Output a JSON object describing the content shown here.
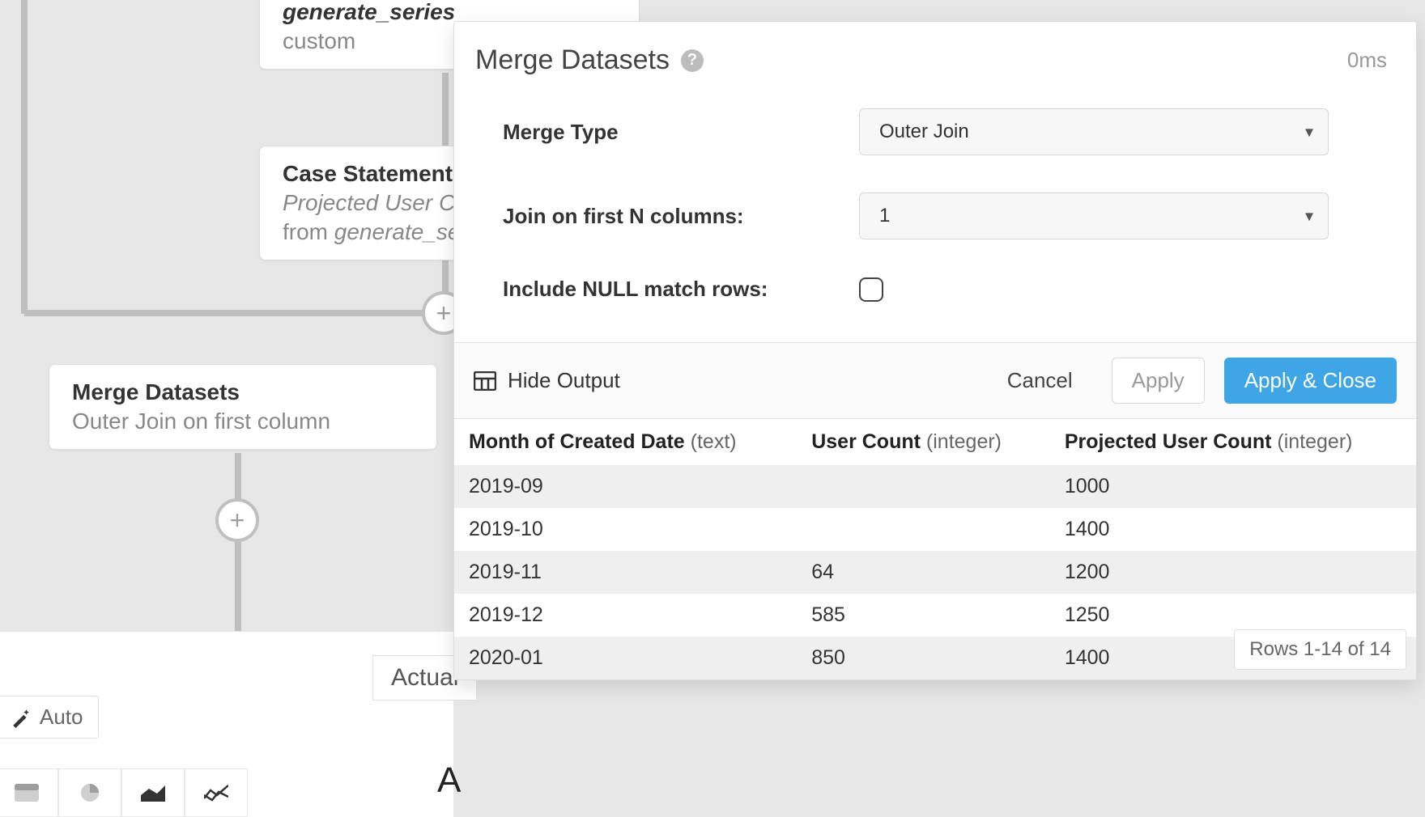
{
  "canvas": {
    "generate_series": {
      "title": "generate_series",
      "subtitle": "custom"
    },
    "case_statement": {
      "title": "Case Statement",
      "subtitle_prefix": "Projected User Cou",
      "subtitle_from": "from ",
      "subtitle_source": "generate_ser"
    },
    "merge_node": {
      "title": "Merge Datasets",
      "subtitle": "Outer Join on first column"
    }
  },
  "panel": {
    "title": "Merge Datasets",
    "timing": "0ms",
    "form": {
      "merge_type_label": "Merge Type",
      "merge_type_value": "Outer Join",
      "join_n_label": "Join on first N columns:",
      "join_n_value": "1",
      "null_rows_label": "Include NULL match rows:",
      "null_rows_checked": false
    },
    "footer": {
      "hide_output": "Hide Output",
      "cancel": "Cancel",
      "apply": "Apply",
      "apply_close": "Apply & Close"
    },
    "columns": [
      {
        "name": "Month of Created Date",
        "type": "(text)"
      },
      {
        "name": "User Count",
        "type": "(integer)"
      },
      {
        "name": "Projected User Count",
        "type": "(integer)"
      }
    ],
    "rows": [
      {
        "month": "2019-09",
        "user_count": "",
        "projected": "1000"
      },
      {
        "month": "2019-10",
        "user_count": "",
        "projected": "1400"
      },
      {
        "month": "2019-11",
        "user_count": "64",
        "projected": "1200"
      },
      {
        "month": "2019-12",
        "user_count": "585",
        "projected": "1250"
      },
      {
        "month": "2020-01",
        "user_count": "850",
        "projected": "1400"
      }
    ],
    "rows_badge": "Rows 1-14 of 14"
  },
  "toolbar": {
    "auto": "Auto",
    "tab_actual": "Actual",
    "big_a": "A"
  }
}
